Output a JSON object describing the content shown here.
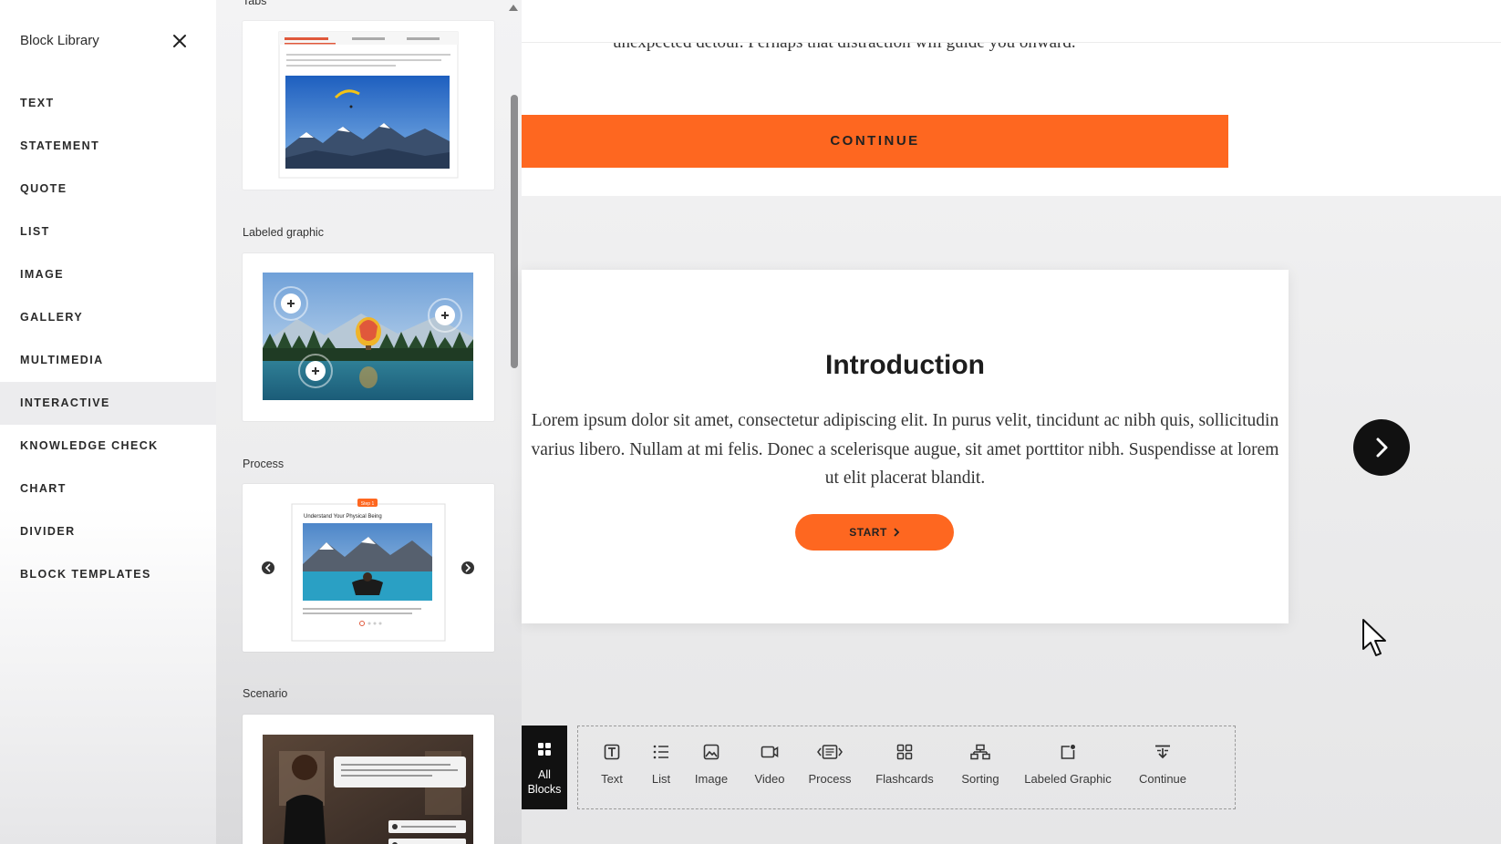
{
  "sidebar": {
    "title": "Block Library",
    "close_icon": "close-icon",
    "items": [
      {
        "label": "TEXT"
      },
      {
        "label": "STATEMENT"
      },
      {
        "label": "QUOTE"
      },
      {
        "label": "LIST"
      },
      {
        "label": "IMAGE"
      },
      {
        "label": "GALLERY"
      },
      {
        "label": "MULTIMEDIA"
      },
      {
        "label": "INTERACTIVE",
        "active": true
      },
      {
        "label": "KNOWLEDGE CHECK"
      },
      {
        "label": "CHART"
      },
      {
        "label": "DIVIDER"
      },
      {
        "label": "BLOCK TEMPLATES"
      }
    ]
  },
  "preview": {
    "sections": [
      {
        "label": "Tabs"
      },
      {
        "label": "Labeled graphic"
      },
      {
        "label": "Process"
      },
      {
        "label": "Scenario"
      }
    ],
    "process_thumb_title": "Understand Your Physical Being",
    "process_thumb_badge": "Step 1"
  },
  "canvas": {
    "top_text": "unexpected detour. Perhaps that distraction will guide you onward.",
    "continue_label": "CONTINUE",
    "intro": {
      "title": "Introduction",
      "body": "Lorem ipsum dolor sit amet, consectetur adipiscing elit. In purus velit, tincidunt ac nibh quis, sollicitudin varius libero. Nullam at mi felis. Donec a scelerisque augue, sit amet porttitor nibh. Suspendisse at lorem ut elit placerat blandit.",
      "start_label": "START"
    }
  },
  "toolbar": {
    "all_blocks_label": "All Blocks",
    "items": [
      {
        "label": "Text",
        "icon": "text-block-icon"
      },
      {
        "label": "List",
        "icon": "list-icon"
      },
      {
        "label": "Image",
        "icon": "image-icon"
      },
      {
        "label": "Video",
        "icon": "video-icon"
      },
      {
        "label": "Process",
        "icon": "process-icon"
      },
      {
        "label": "Flashcards",
        "icon": "flashcards-icon"
      },
      {
        "label": "Sorting",
        "icon": "sorting-icon"
      },
      {
        "label": "Labeled Graphic",
        "icon": "labeled-graphic-icon"
      },
      {
        "label": "Continue",
        "icon": "continue-icon"
      }
    ]
  },
  "colors": {
    "accent": "#fe6720",
    "dark": "#111111"
  }
}
